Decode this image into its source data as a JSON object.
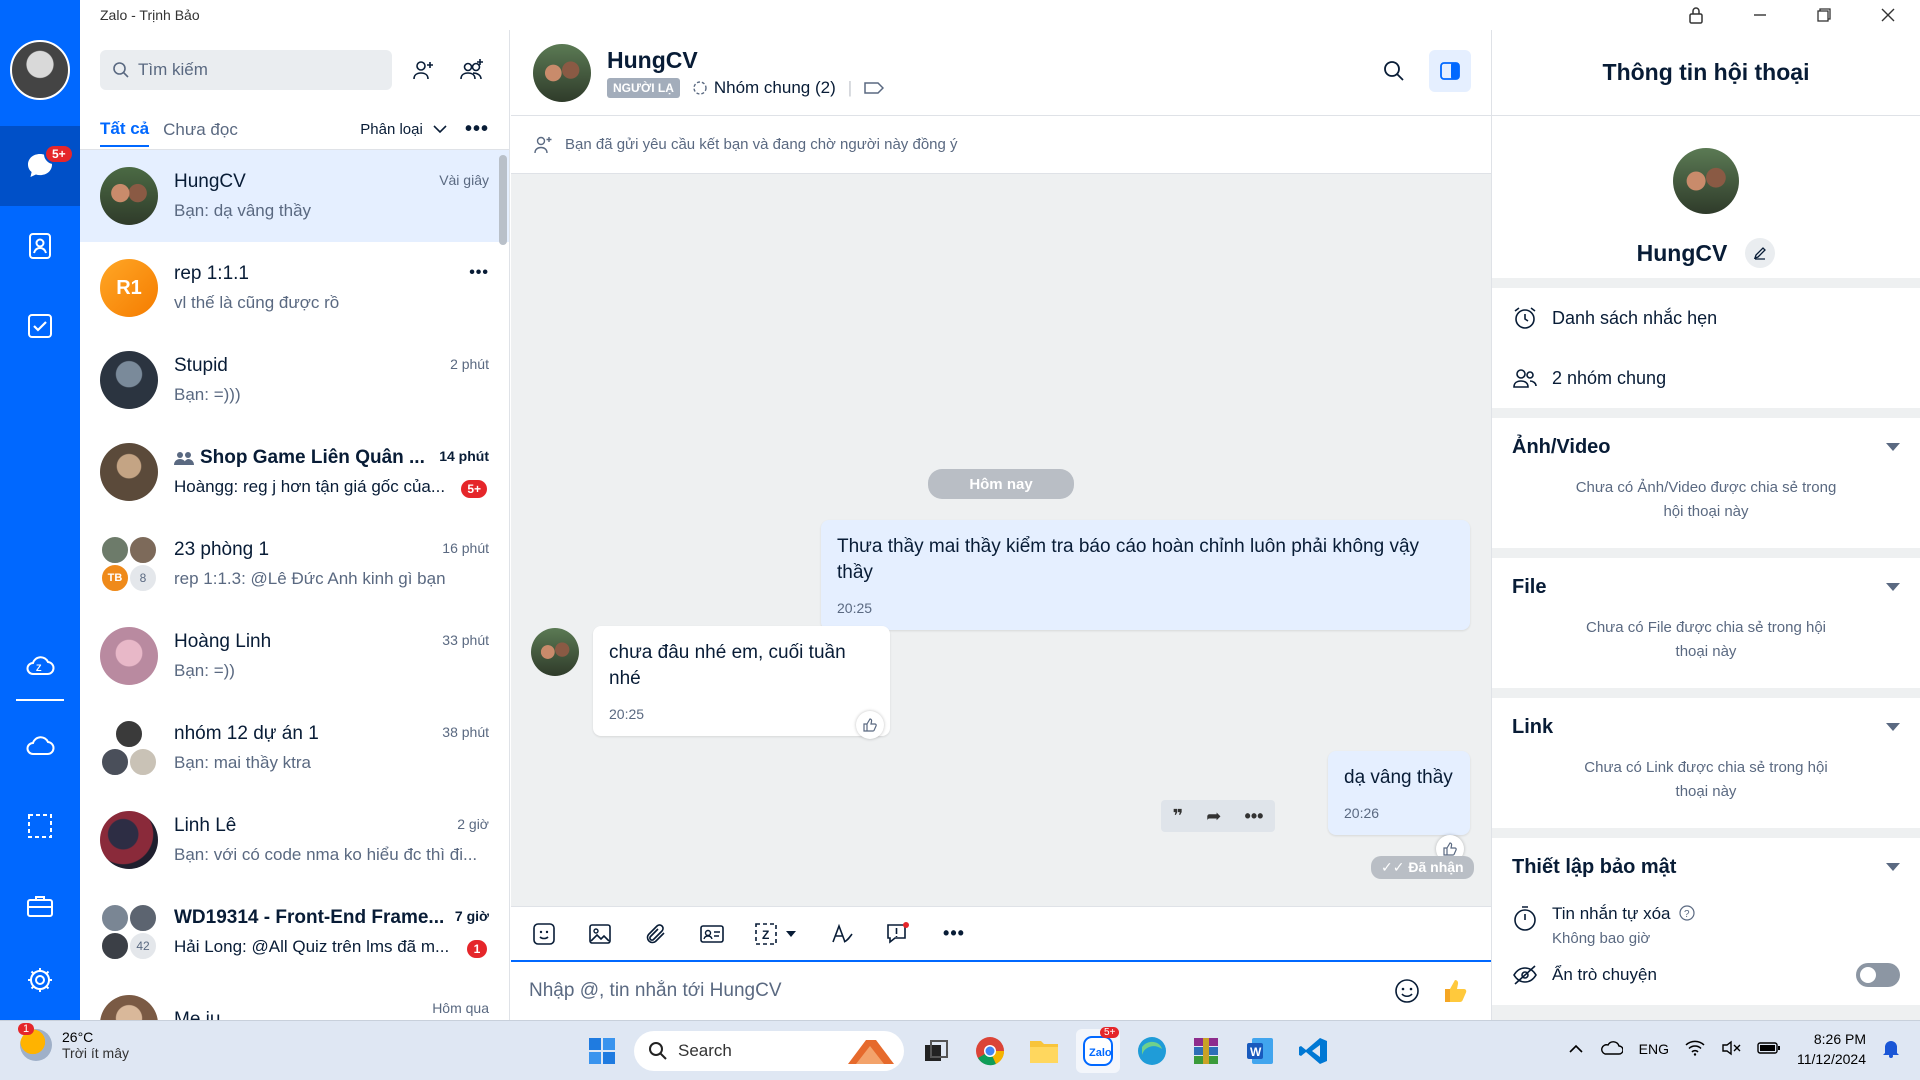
{
  "window": {
    "title": "Zalo - Trịnh Bảo"
  },
  "nav": {
    "badge": "5+"
  },
  "sidebar": {
    "search_placeholder": "Tìm kiếm",
    "tabs": [
      "Tất cả",
      "Chưa đọc"
    ],
    "classify": "Phân loại",
    "conversations": [
      {
        "name": "HungCV",
        "preview": "Bạn: dạ vâng thầy",
        "time": "Vài giây",
        "active": true,
        "bold": false
      },
      {
        "name": "rep 1:1.1",
        "preview": "vl thế là cũng được rồ",
        "time": "",
        "initials": "R1",
        "bold": false
      },
      {
        "name": "Stupid",
        "preview": "Bạn: =)))",
        "time": "2 phút",
        "bold": false
      },
      {
        "name": "Shop Game Liên Quân ...",
        "preview": "Hoàngg: reg j hơn tận giá gốc của...",
        "time": "14 phút",
        "badge": "5+",
        "bold": true
      },
      {
        "name": "23 phòng 1",
        "preview": "rep 1:1.3: @Lê Đức Anh kinh gì bạn",
        "time": "16 phút",
        "initials": "TB",
        "member_count": "8",
        "bold": false
      },
      {
        "name": "Hoàng Linh",
        "preview": "Bạn: =))",
        "time": "33 phút",
        "bold": false
      },
      {
        "name": "nhóm 12 dự án 1",
        "preview": "Bạn: mai thầy ktra",
        "time": "38 phút",
        "bold": false
      },
      {
        "name": "Linh Lê",
        "preview": "Bạn: với có code nma ko hiểu đc thì đi...",
        "time": "2 giờ",
        "bold": false
      },
      {
        "name": "WD19314 - Front-End Frame...",
        "preview": "Hải Long: @All Quiz trên lms đã m...",
        "time": "7 giờ",
        "badge": "1",
        "member_count": "42",
        "bold": true
      },
      {
        "name": "Me iu",
        "preview": "",
        "time": "Hôm qua",
        "bold": false
      }
    ]
  },
  "chat": {
    "name": "HungCV",
    "stranger_tag": "NGƯỜI LẠ",
    "common_groups": "Nhóm chung (2)",
    "notice": "Bạn đã gửi yêu cầu kết bạn và đang chờ người này đồng ý",
    "day_separator": "Hôm nay",
    "messages": [
      {
        "from": "me",
        "text": "Thưa thầy mai thầy kiểm tra báo cáo hoàn chỉnh luôn phải không vậy thầy",
        "time": "20:25"
      },
      {
        "from": "them",
        "text": "chưa đâu nhé em, cuối tuần nhé",
        "time": "20:25"
      },
      {
        "from": "me",
        "text": "dạ vâng thầy",
        "time": "20:26"
      }
    ],
    "received_label": "Đã nhận",
    "input_placeholder": "Nhập @, tin nhắn tới HungCV"
  },
  "info_panel": {
    "title": "Thông tin hội thoại",
    "name": "HungCV",
    "reminders": "Danh sách nhắc hẹn",
    "groups": "2 nhóm chung",
    "media": {
      "title": "Ảnh/Video",
      "empty": "Chưa có Ảnh/Video được chia sẻ trong hội thoại này"
    },
    "files": {
      "title": "File",
      "empty": "Chưa có File được chia sẻ trong hội thoại này"
    },
    "links": {
      "title": "Link",
      "empty": "Chưa có Link được chia sẻ trong hội thoại này"
    },
    "security": {
      "title": "Thiết lập bảo mật",
      "self_destruct": "Tin nhắn tự xóa",
      "self_destruct_value": "Không bao giờ",
      "hide_chat": "Ẩn trò chuyện"
    }
  },
  "taskbar": {
    "weather_badge": "1",
    "temp": "26°C",
    "condition": "Trời ít mây",
    "search": "Search",
    "zalo_badge": "5+",
    "lang": "ENG",
    "time": "8:26 PM",
    "date": "11/12/2024"
  },
  "colors": {
    "accent": "#0068ff",
    "badge": "#e5262a"
  }
}
